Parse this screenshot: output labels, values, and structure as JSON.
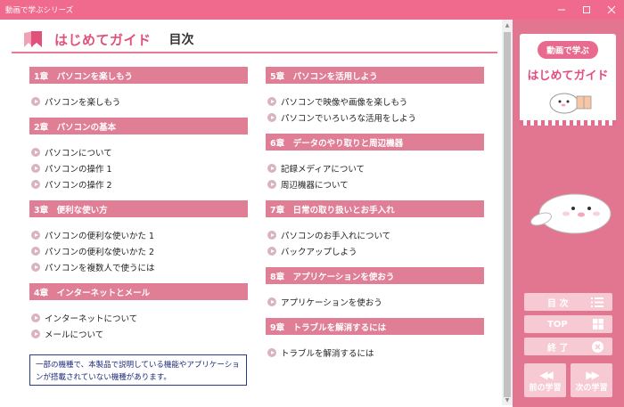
{
  "window": {
    "title": "動画で学ぶシリーズ"
  },
  "header": {
    "title": "はじめてガイド",
    "subtitle": "目次"
  },
  "left_column": [
    {
      "chapter": "1章　パソコンを楽しもう",
      "items": [
        "パソコンを楽しもう"
      ]
    },
    {
      "chapter": "2章　パソコンの基本",
      "items": [
        "パソコンについて",
        "パソコンの操作 1",
        "パソコンの操作 2"
      ]
    },
    {
      "chapter": "3章　便利な使い方",
      "items": [
        "パソコンの便利な使いかた 1",
        "パソコンの便利な使いかた 2",
        "パソコンを複数人で使うには"
      ]
    },
    {
      "chapter": "4章　インターネットとメール",
      "items": [
        "インターネットについて",
        "メールについて"
      ]
    }
  ],
  "right_column": [
    {
      "chapter": "5章　パソコンを活用しよう",
      "items": [
        "パソコンで映像や画像を楽しもう",
        "パソコンでいろいろな活用をしよう"
      ]
    },
    {
      "chapter": "6章　データのやり取りと周辺機器",
      "items": [
        "記録メディアについて",
        "周辺機器について"
      ]
    },
    {
      "chapter": "7章　日常の取り扱いとお手入れ",
      "items": [
        "パソコンのお手入れについて",
        "バックアップしよう"
      ]
    },
    {
      "chapter": "8章　アプリケーションを使おう",
      "items": [
        "アプリケーションを使おう"
      ]
    },
    {
      "chapter": "9章　トラブルを解消するには",
      "items": [
        "トラブルを解消するには"
      ]
    }
  ],
  "notice": "一部の機種で、本製品で説明している機能やアプリケーションが搭載されていない機種があります。",
  "sidebar": {
    "logo_top": "動画で学ぶ",
    "logo_main": "はじめてガイド",
    "buttons": [
      {
        "label": "目 次",
        "icon": "list-icon"
      },
      {
        "label": "TOP",
        "icon": "windows-icon"
      },
      {
        "label": "終 了",
        "icon": "close-circle-icon"
      }
    ],
    "prev_label": "前の学習",
    "next_label": "次の学習"
  },
  "colors": {
    "accent": "#e07e96",
    "titlebar": "#f06a8e",
    "panel": "#e2758f"
  }
}
